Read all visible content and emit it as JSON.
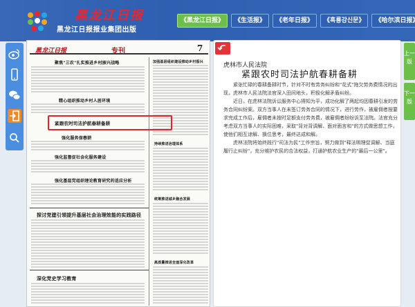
{
  "header": {
    "logo_title": "黑龙江日报",
    "logo_subtitle": "黑龙江日报报业集团出版",
    "publications": [
      {
        "label": "《黑龙江日报》",
        "active": true
      },
      {
        "label": "《生活报》",
        "active": false
      },
      {
        "label": "《老年日报》",
        "active": false
      },
      {
        "label": "《흑룡강신문》",
        "active": false
      },
      {
        "label": "《哈尔滨日报》",
        "active": false
      }
    ]
  },
  "sidebar": {
    "icons": [
      "weibo-icon",
      "mobile-icon",
      "wechat-icon",
      "login-icon",
      "search-icon"
    ]
  },
  "newspaper": {
    "masthead": "黑龙江日报",
    "section": "专刊",
    "page_number": "7",
    "headlines": [
      "聚焦\"三农\"扎实推进乡村振兴战略",
      "精心组织推动乡村人居环境",
      "紧跟农时司法护航春耕备耕",
      "强化服务保春耕",
      "强化监督促社会化服务建设",
      "强化基层党组织理论教育研究的适应分析",
      "探讨党建引领提升基层社会治理效能的实践路径",
      "深化党史学习教育",
      "加强基层组织建设推动乡村振兴",
      "持续推进治理体系",
      "统筹推进城乡融合发展",
      "高质量推进全面深化改革"
    ]
  },
  "article": {
    "source": "虎林市人民法院",
    "title": "紧跟农时司法护航春耕备耕",
    "paragraphs": [
      "紧张忙碌的春耕备耕时节，针对不时有劳务纠纷和\"花式\"拖欠劳务费情况的出现，虎林市人民法院法官深入田间地头，积极化解矛盾纠纷。",
      "近日，在虎林法院诉讼服务中心得知为平，成功化解了两起均因春耕引发的劳务合同纠纷案。双方当事人在未签订劳务合同的情况下，进行劳作，被雇佣者按要求完成工作后，雇佣者未按时足额支付劳务费，被雇佣者纷纷诉至法院。法官充分考虑双方当事人的实际困难，采取\"背对背调解、面对面言和\"的方式做思想工作，使他们相互谅解、换位思考，最终达成和解。",
      "虎林法院将始终践行\"司法为民\"工作宗旨，努力做到\"释法明理促调解、当庭履行止纠纷\"，充分维护农民的合法权益，打通护航农业生产的\"最后一公里\"。"
    ]
  },
  "pagenav": {
    "prev_label": "上一版",
    "next_label": "下一版"
  },
  "colors": {
    "header_blue": "#3a68b8",
    "active_green": "#6cc04a",
    "highlight_red": "#e0242b"
  }
}
